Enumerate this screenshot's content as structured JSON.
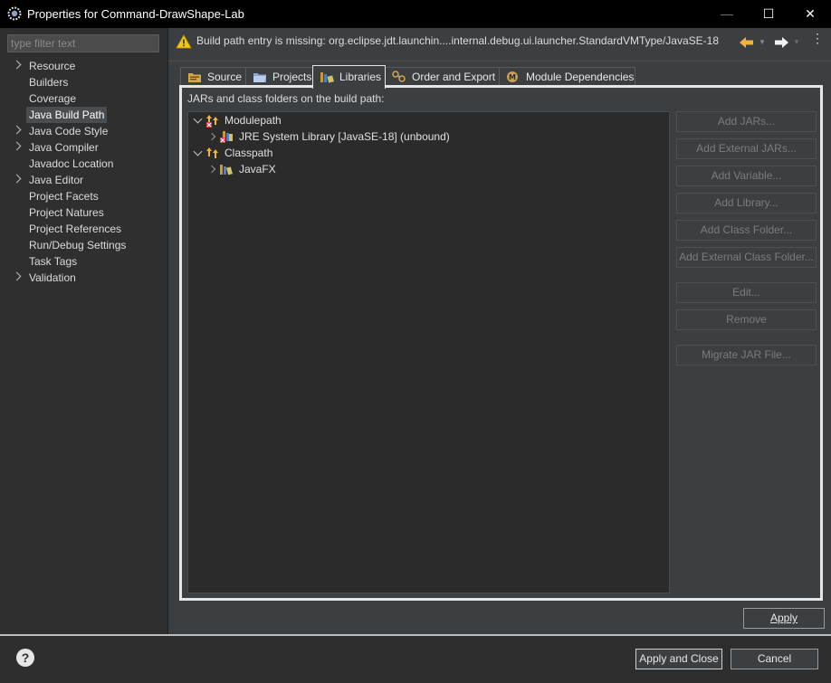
{
  "window": {
    "title": "Properties for Command-DrawShape-Lab",
    "app_icon": "eclipse-gear-icon",
    "controls": {
      "minimize": "—",
      "maximize": "☐",
      "close": "✕"
    }
  },
  "filter": {
    "placeholder": "type filter text",
    "value": ""
  },
  "nav": {
    "items": [
      {
        "label": "Resource",
        "expandable": true
      },
      {
        "label": "Builders",
        "expandable": false
      },
      {
        "label": "Coverage",
        "expandable": false
      },
      {
        "label": "Java Build Path",
        "expandable": false,
        "selected": true
      },
      {
        "label": "Java Code Style",
        "expandable": true
      },
      {
        "label": "Java Compiler",
        "expandable": true
      },
      {
        "label": "Javadoc Location",
        "expandable": false
      },
      {
        "label": "Java Editor",
        "expandable": true
      },
      {
        "label": "Project Facets",
        "expandable": false
      },
      {
        "label": "Project Natures",
        "expandable": false
      },
      {
        "label": "Project References",
        "expandable": false
      },
      {
        "label": "Run/Debug Settings",
        "expandable": false
      },
      {
        "label": "Task Tags",
        "expandable": false
      },
      {
        "label": "Validation",
        "expandable": true
      }
    ]
  },
  "header": {
    "warning_icon": "warning-triangle-icon",
    "warning": "Build path entry is missing: org.eclipse.jdt.launchin....internal.debug.ui.launcher.StandardVMType/JavaSE-18",
    "back_icon": "arrow-left-icon",
    "forward_icon": "arrow-right-icon",
    "menu_icon": "kebab-menu-icon",
    "kebab": "⋮",
    "dropdown": "▼"
  },
  "tabs": [
    {
      "label": "Source",
      "icon": "source-folder-icon"
    },
    {
      "label": "Projects",
      "icon": "projects-folder-icon"
    },
    {
      "label": "Libraries",
      "icon": "libraries-icon",
      "active": true
    },
    {
      "label": "Order and Export",
      "icon": "order-export-icon"
    },
    {
      "label": "Module Dependencies",
      "icon": "module-icon"
    }
  ],
  "libraries": {
    "path_label": "JARs and class folders on the build path:",
    "tree": {
      "modulepath": "Modulepath",
      "jre": "JRE System Library [JavaSE-18] (unbound)",
      "classpath": "Classpath",
      "javafx": "JavaFX"
    },
    "buttons": {
      "add_jars": "Add JARs...",
      "add_external_jars": "Add External JARs...",
      "add_variable": "Add Variable...",
      "add_library": "Add Library...",
      "add_class_folder": "Add Class Folder...",
      "add_external_class_folder": "Add External Class Folder...",
      "edit": "Edit...",
      "remove": "Remove",
      "migrate_jar": "Migrate JAR File..."
    }
  },
  "footer": {
    "apply": "Apply",
    "apply_and_close": "Apply and Close",
    "cancel": "Cancel",
    "help": "?"
  },
  "colors": {
    "warning": "#f0c419",
    "nav_arrow": "#f2b33d",
    "error": "#e23b3b",
    "library": "#c89a3a"
  }
}
